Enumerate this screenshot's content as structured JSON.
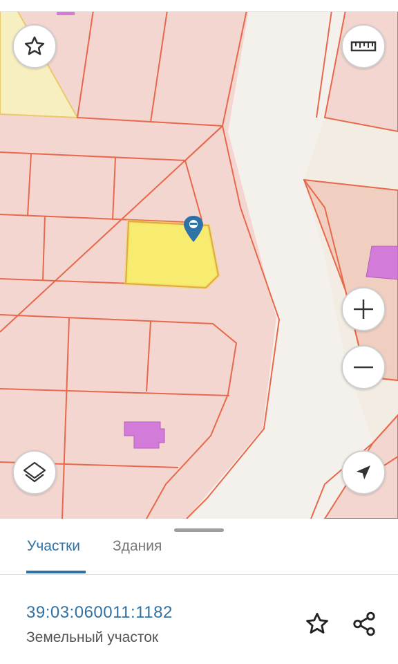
{
  "map": {
    "controls": {
      "favorite": "star-icon",
      "ruler": "ruler-icon",
      "zoom_in": "plus-icon",
      "zoom_out": "minus-icon",
      "layers": "layers-icon",
      "locate": "navigation-arrow-icon"
    },
    "colors": {
      "parcel_fill": "#f3d6cf",
      "parcel_border": "#e7684a",
      "selected_parcel": "#f7ec6f",
      "building": "#d27bd8",
      "road": "#f4f1ec",
      "marker": "#2f72a6"
    }
  },
  "sheet": {
    "tabs": [
      {
        "label": "Участки",
        "active": true
      },
      {
        "label": "Здания",
        "active": false
      }
    ],
    "parcel": {
      "cadastral_number": "39:03:060011:1182",
      "type": "Земельный участок"
    },
    "actions": {
      "favorite": "star-outline-icon",
      "share": "share-icon"
    }
  }
}
